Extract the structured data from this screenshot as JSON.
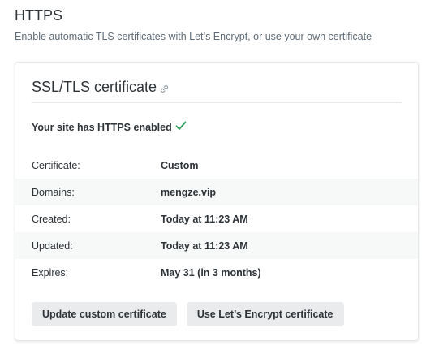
{
  "section": {
    "title": "HTTPS",
    "description": "Enable automatic TLS certificates with Let’s Encrypt, or use your own certificate"
  },
  "card": {
    "title": "SSL/TLS certificate",
    "link_icon": "link-icon",
    "status_text": "Your site has HTTPS enabled",
    "status_icon": "checkmark-icon",
    "status_color": "#2e9e5b",
    "rows": [
      {
        "label": "Certificate:",
        "value": "Custom"
      },
      {
        "label": "Domains:",
        "value": "mengze.vip"
      },
      {
        "label": "Created:",
        "value": "Today at 11:23 AM"
      },
      {
        "label": "Updated:",
        "value": "Today at 11:23 AM"
      },
      {
        "label": "Expires:",
        "value": "May 31 (in 3 months)"
      }
    ],
    "buttons": {
      "update_custom": "Update custom certificate",
      "use_letsencrypt": "Use Let’s Encrypt certificate"
    }
  }
}
